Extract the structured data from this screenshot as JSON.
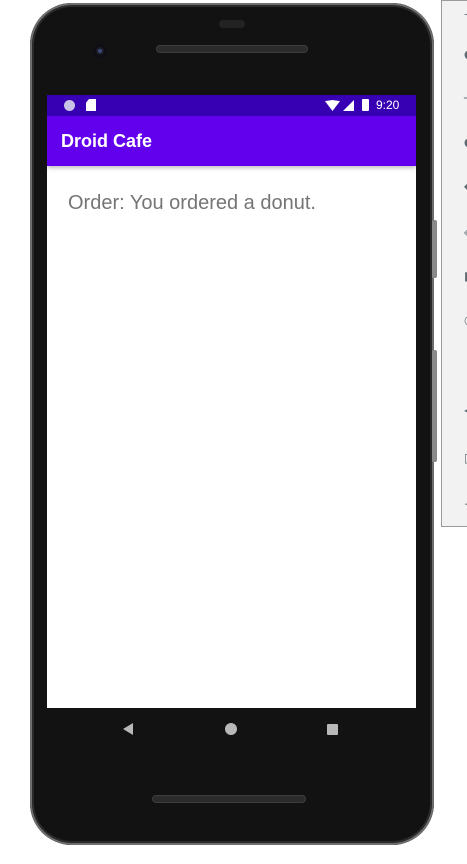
{
  "status_bar": {
    "time": "9:20",
    "icons": [
      "notification-dot-icon",
      "sd-card-icon",
      "wifi-icon",
      "cell-signal-icon",
      "battery-icon"
    ]
  },
  "app_bar": {
    "title": "Droid Cafe"
  },
  "content": {
    "order_text": "Order: You ordered a donut."
  },
  "nav_bar": {
    "icons": [
      "back-icon",
      "home-icon",
      "recents-icon"
    ]
  },
  "emulator_toolbar": {
    "icons": [
      "power-icon",
      "volume-up-icon",
      "volume-down-icon",
      "rotate-left-icon",
      "rotate-right-icon",
      "screenshot-icon",
      "zoom-icon",
      "back-icon",
      "home-icon",
      "overview-icon",
      "more-icon"
    ]
  },
  "colors": {
    "status_bar": "#3700b3",
    "app_bar": "#6200ee",
    "order_text": "#757575"
  }
}
